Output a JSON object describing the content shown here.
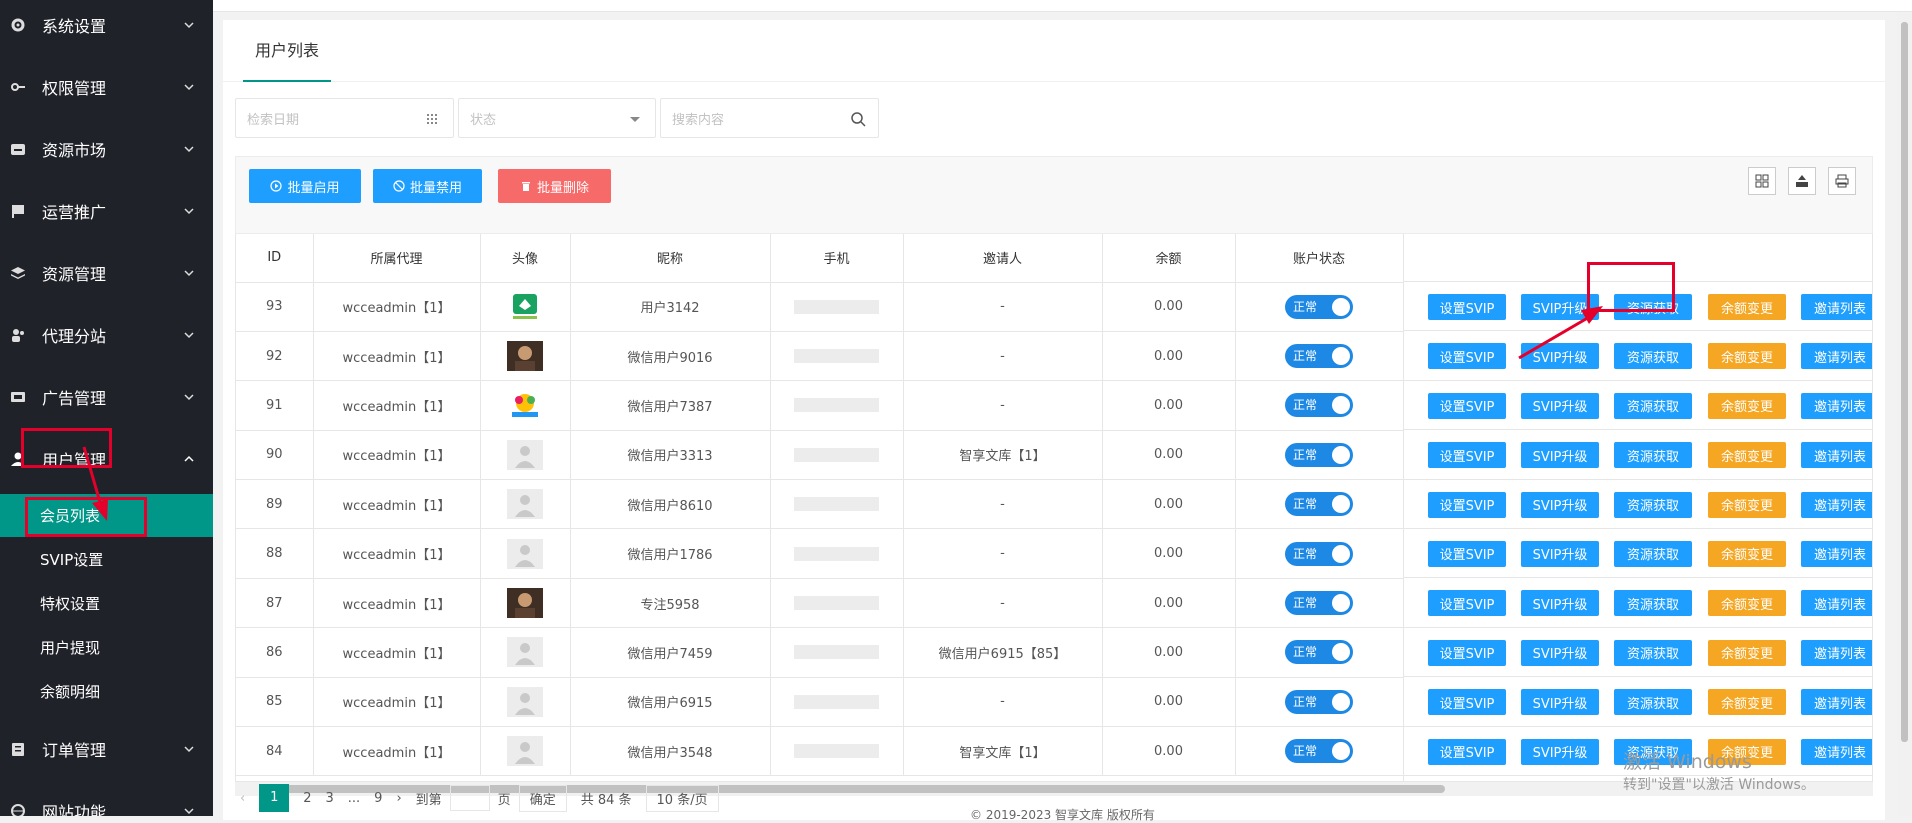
{
  "sidebar": {
    "items": [
      {
        "label": "系统设置",
        "icon": "gear-icon",
        "expanded": false
      },
      {
        "label": "权限管理",
        "icon": "key-icon",
        "expanded": false
      },
      {
        "label": "资源市场",
        "icon": "store-icon",
        "expanded": false
      },
      {
        "label": "运营推广",
        "icon": "flag-icon",
        "expanded": false
      },
      {
        "label": "资源管理",
        "icon": "layers-icon",
        "expanded": false
      },
      {
        "label": "代理分站",
        "icon": "users-icon",
        "expanded": false
      },
      {
        "label": "广告管理",
        "icon": "ad-icon",
        "expanded": false
      },
      {
        "label": "用户管理",
        "icon": "user-icon",
        "expanded": true
      },
      {
        "label": "订单管理",
        "icon": "clipboard-icon",
        "expanded": false
      },
      {
        "label": "网站功能",
        "icon": "globe-icon",
        "expanded": false
      }
    ],
    "subitems": [
      "会员列表",
      "SVIP设置",
      "特权设置",
      "用户提现",
      "余额明细"
    ],
    "active_subitem": "会员列表"
  },
  "page": {
    "tab": "用户列表"
  },
  "filters": {
    "date_placeholder": "检索日期",
    "status_placeholder": "状态",
    "search_placeholder": "搜索内容"
  },
  "toolbar": {
    "batch_enable": "批量启用",
    "batch_disable": "批量禁用",
    "batch_delete": "批量删除"
  },
  "table": {
    "columns": [
      "ID",
      "所属代理",
      "头像",
      "昵称",
      "手机",
      "邀请人",
      "余额",
      "账户状态"
    ],
    "rows": [
      {
        "id": "93",
        "agent": "wcceadmin【1】",
        "avatar": "logo",
        "nickname": "用户3142",
        "inviter": "-",
        "balance": "0.00",
        "status": "正常"
      },
      {
        "id": "92",
        "agent": "wcceadmin【1】",
        "avatar": "photo",
        "nickname": "微信用户9016",
        "inviter": "-",
        "balance": "0.00",
        "status": "正常"
      },
      {
        "id": "91",
        "agent": "wcceadmin【1】",
        "avatar": "colorful",
        "nickname": "微信用户7387",
        "inviter": "-",
        "balance": "0.00",
        "status": "正常"
      },
      {
        "id": "90",
        "agent": "wcceadmin【1】",
        "avatar": "default",
        "nickname": "微信用户3313",
        "inviter": "智享文库【1】",
        "balance": "0.00",
        "status": "正常"
      },
      {
        "id": "89",
        "agent": "wcceadmin【1】",
        "avatar": "default",
        "nickname": "微信用户8610",
        "inviter": "-",
        "balance": "0.00",
        "status": "正常"
      },
      {
        "id": "88",
        "agent": "wcceadmin【1】",
        "avatar": "default",
        "nickname": "微信用户1786",
        "inviter": "-",
        "balance": "0.00",
        "status": "正常"
      },
      {
        "id": "87",
        "agent": "wcceadmin【1】",
        "avatar": "photo",
        "nickname": "专注5958",
        "inviter": "-",
        "balance": "0.00",
        "status": "正常"
      },
      {
        "id": "86",
        "agent": "wcceadmin【1】",
        "avatar": "default",
        "nickname": "微信用户7459",
        "inviter": "微信用户6915【85】",
        "balance": "0.00",
        "status": "正常"
      },
      {
        "id": "85",
        "agent": "wcceadmin【1】",
        "avatar": "default",
        "nickname": "微信用户6915",
        "inviter": "-",
        "balance": "0.00",
        "status": "正常"
      },
      {
        "id": "84",
        "agent": "wcceadmin【1】",
        "avatar": "default",
        "nickname": "微信用户3548",
        "inviter": "智享文库【1】",
        "balance": "0.00",
        "status": "正常"
      }
    ],
    "actions": [
      "设置SVIP",
      "SVIP升级",
      "资源获取",
      "余额变更",
      "邀请列表"
    ]
  },
  "pager": {
    "current": "1",
    "items": [
      "2",
      "3",
      "...",
      "9"
    ],
    "goto_label": "到第",
    "page_unit": "页",
    "confirm": "确定",
    "total": "共 84 条",
    "page_size": "10 条/页"
  },
  "watermark": {
    "line1": "激活 Windows",
    "line2": "转到\"设置\"以激活 Windows。"
  },
  "footer": {
    "text": "© 2019-2023 智享文库 版权所有"
  },
  "colors": {
    "sidebar": "#20222a",
    "active": "#009688",
    "primary": "#1e9fff",
    "warm": "#ffb800",
    "danger": "#ff5722",
    "highlight": "#e4002b"
  }
}
